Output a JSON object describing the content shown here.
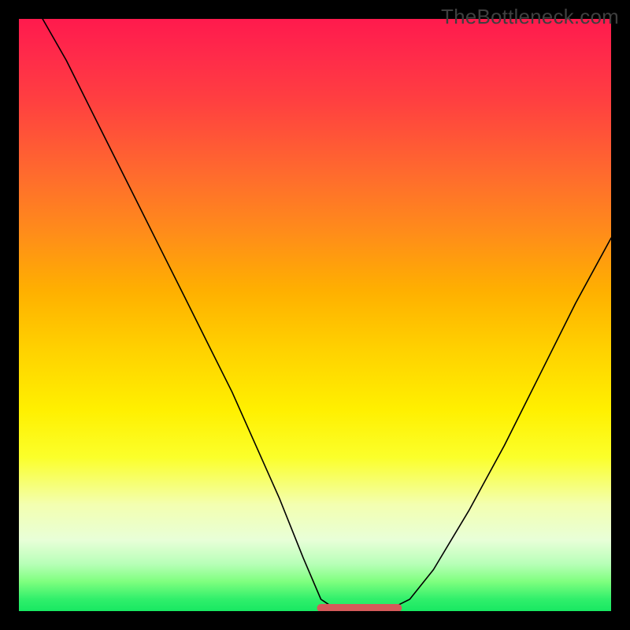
{
  "watermark": "TheBottleneck.com",
  "colors": {
    "frame": "#000000",
    "curve": "#000000",
    "valley_highlight": "#d45a5a",
    "gradient_top": "#ff1a4d",
    "gradient_bottom": "#18e862"
  },
  "chart_data": {
    "type": "line",
    "title": "",
    "xlabel": "",
    "ylabel": "",
    "xlim": [
      0,
      1
    ],
    "ylim": [
      0,
      1
    ],
    "grid": false,
    "legend": false,
    "series": [
      {
        "name": "bottleneck-curve",
        "x": [
          0.04,
          0.08,
          0.12,
          0.16,
          0.2,
          0.24,
          0.28,
          0.32,
          0.36,
          0.4,
          0.44,
          0.48,
          0.51,
          0.54,
          0.58,
          0.62,
          0.66,
          0.7,
          0.76,
          0.82,
          0.88,
          0.94,
          1.0
        ],
        "y": [
          1.0,
          0.93,
          0.85,
          0.77,
          0.69,
          0.61,
          0.53,
          0.45,
          0.37,
          0.28,
          0.19,
          0.09,
          0.02,
          0.0,
          0.0,
          0.0,
          0.02,
          0.07,
          0.17,
          0.28,
          0.4,
          0.52,
          0.63
        ]
      }
    ],
    "annotations": [
      {
        "name": "valley-highlight",
        "x_start": 0.51,
        "x_end": 0.64,
        "y": 0.0
      }
    ]
  }
}
